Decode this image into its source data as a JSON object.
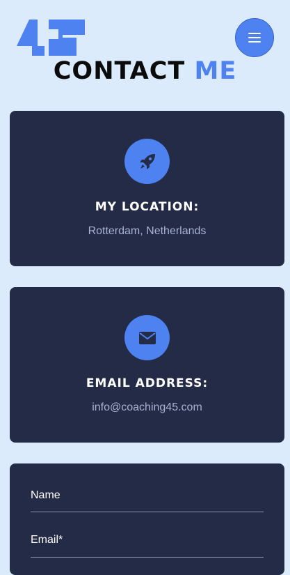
{
  "header": {
    "logo_icon": "coaching45-logo",
    "menu_icon": "hamburger-icon",
    "title_main": "CONTACT",
    "title_accent": "ME"
  },
  "cards": {
    "location": {
      "icon": "rocket-icon",
      "heading": "MY LOCATION:",
      "value": "Rotterdam, Netherlands"
    },
    "email": {
      "icon": "envelope-icon",
      "heading": "EMAIL ADDRESS:",
      "value": "info@coaching45.com"
    }
  },
  "form": {
    "name_label": "Name",
    "email_label": "Email*"
  },
  "colors": {
    "background": "#dcebfb",
    "card": "#232b47",
    "accent": "#4d82f0",
    "muted_text": "#a9b2d3"
  }
}
